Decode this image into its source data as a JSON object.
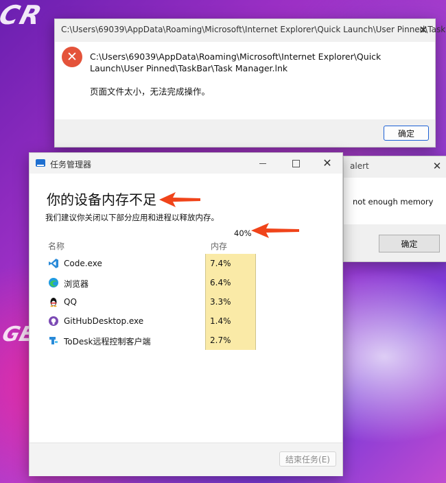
{
  "background": {
    "deco_text_top": "CR",
    "deco_text_side": "GE"
  },
  "error_dialog": {
    "title": "C:\\Users\\69039\\AppData\\Roaming\\Microsoft\\Internet Explorer\\Quick Launch\\User Pinned\\Task...",
    "message_path": "C:\\Users\\69039\\AppData\\Roaming\\Microsoft\\Internet Explorer\\Quick Launch\\User Pinned\\TaskBar\\Task Manager.lnk",
    "message": "页面文件太小，无法完成操作。",
    "ok_label": "确定",
    "close_glyph": "✕",
    "icon": "error-x-icon",
    "icon_glyph": "✕",
    "icon_color": "#e4533a"
  },
  "alert_window": {
    "title": "alert",
    "message": "not enough memory",
    "ok_label": "确定",
    "close_glyph": "✕"
  },
  "task_manager": {
    "title": "任务管理器",
    "heading": "你的设备内存不足",
    "subtitle": "我们建议你关闭以下部分应用和进程以释放内存。",
    "total_percent": "40%",
    "columns": {
      "name": "名称",
      "memory": "内存"
    },
    "processes": [
      {
        "name": "Code.exe",
        "memory": "7.4%",
        "icon": "vscode-icon"
      },
      {
        "name": "浏览器",
        "memory": "6.4%",
        "icon": "edge-browser-icon"
      },
      {
        "name": "QQ",
        "memory": "3.3%",
        "icon": "qq-penguin-icon"
      },
      {
        "name": "GitHubDesktop.exe",
        "memory": "1.4%",
        "icon": "github-desktop-icon"
      },
      {
        "name": "ToDesk远程控制客户端",
        "memory": "2.7%",
        "icon": "todesk-icon"
      }
    ],
    "end_task_label": "结束任务(E)",
    "close_glyph": "✕",
    "memory_highlight_color": "#faeaa7"
  },
  "annotations": {
    "arrow_color": "#f0441a"
  }
}
